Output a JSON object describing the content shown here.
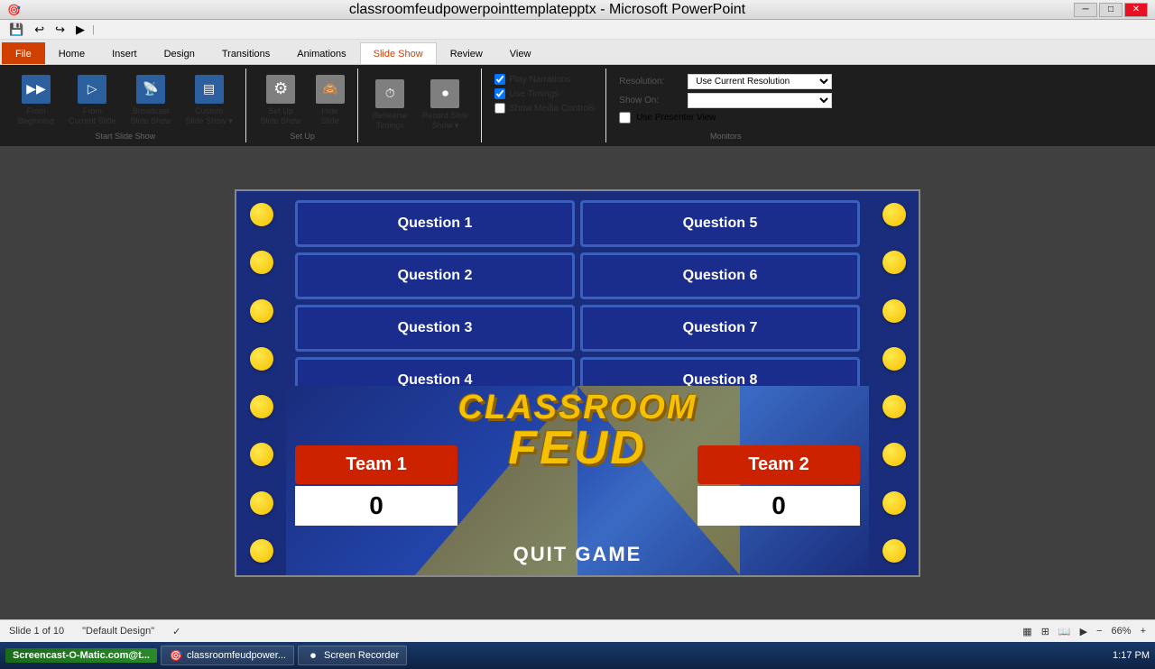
{
  "window": {
    "title": "classroomfeudpowerpointtemplatepptx - Microsoft PowerPoint",
    "controls": [
      "─",
      "□",
      "✕"
    ]
  },
  "quickaccess": {
    "buttons": [
      "💾",
      "↩",
      "↪",
      "▶"
    ]
  },
  "ribbon": {
    "tabs": [
      "File",
      "Home",
      "Insert",
      "Design",
      "Transitions",
      "Animations",
      "Slide Show",
      "Review",
      "View"
    ],
    "active_tab": "Slide Show",
    "groups": {
      "start_slideshow": {
        "label": "Start Slide Show",
        "buttons": [
          {
            "id": "from-beginning",
            "label": "From\nBeginning",
            "icon": "▶"
          },
          {
            "id": "from-current",
            "label": "From\nCurrent Slide",
            "icon": "▶"
          },
          {
            "id": "broadcast",
            "label": "Broadcast\nSlide Show",
            "icon": "📡"
          },
          {
            "id": "custom",
            "label": "Custom\nSlide Show",
            "icon": "▶"
          }
        ]
      },
      "setup": {
        "label": "Set Up",
        "buttons": [
          {
            "id": "setup-slide-show",
            "label": "Set Up\nSlide Show",
            "icon": "⚙"
          },
          {
            "id": "hide-slide",
            "label": "Hide\nSlide",
            "icon": "👁"
          }
        ]
      },
      "timings": {
        "label": "",
        "buttons": [
          {
            "id": "rehearse",
            "label": "Rehearse\nTimings",
            "icon": "⏱"
          },
          {
            "id": "record",
            "label": "Record Slide\nShow",
            "icon": "⏺"
          }
        ]
      },
      "checkboxes": {
        "play_narrations": {
          "label": "Play Narrations",
          "checked": true
        },
        "use_timings": {
          "label": "Use Timings",
          "checked": true
        },
        "show_media": {
          "label": "Show Media Controls",
          "checked": false
        }
      },
      "monitors": {
        "label": "Monitors",
        "resolution_label": "Resolution:",
        "resolution_value": "Use Current Resolution",
        "show_on_label": "Show On:",
        "show_on_value": "",
        "presenter_view_label": "Use Presenter View",
        "presenter_view_checked": false
      }
    }
  },
  "slide": {
    "questions": [
      "Question 1",
      "Question 5",
      "Question 2",
      "Question 6",
      "Question 3",
      "Question 7",
      "Question 4",
      "Question 8"
    ],
    "classroom_text": "CLASSROOM",
    "feud_text": "FEUD",
    "team1": {
      "label": "Team 1",
      "score": "0"
    },
    "team2": {
      "label": "Team 2",
      "score": "0"
    },
    "quit_label": "QUIT GAME"
  },
  "status_bar": {
    "slide_info": "Slide 1 of 10",
    "theme": "\"Default Design\"",
    "zoom": "66%"
  },
  "taskbar": {
    "screencast_label": "Screencast-O-Matic.com@t...",
    "powerpoint_label": "classroomfeudpower...",
    "recorder_label": "Screen Recorder",
    "time": "1:17 PM"
  },
  "dots_count": 8
}
